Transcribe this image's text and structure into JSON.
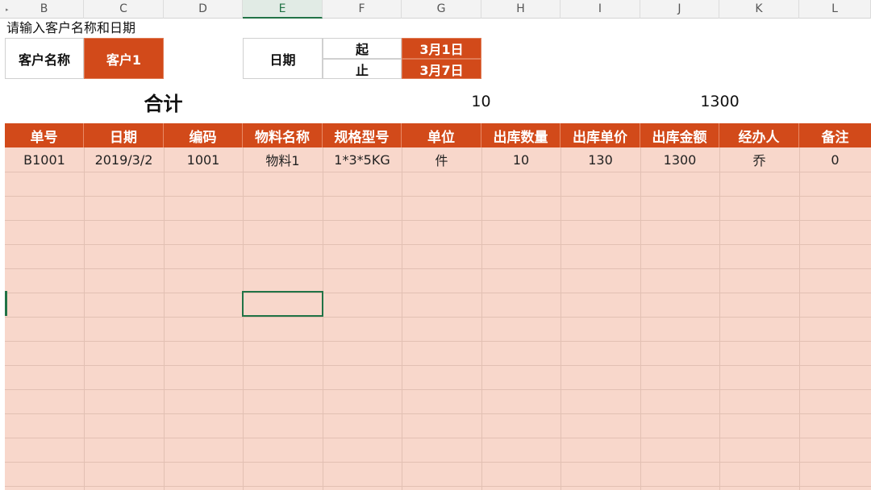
{
  "column_headers": [
    "B",
    "C",
    "D",
    "E",
    "F",
    "G",
    "H",
    "I",
    "J",
    "K",
    "L"
  ],
  "active_column": "E",
  "prompt_text": "请输入客户名称和日期",
  "customer": {
    "label": "客户名称",
    "value": "客户1"
  },
  "date_range": {
    "label": "日期",
    "start_label": "起",
    "start_value": "3月1日",
    "end_label": "止",
    "end_value": "3月7日"
  },
  "totals": {
    "label": "合计",
    "quantity": "10",
    "amount": "1300"
  },
  "table": {
    "headers": [
      "单号",
      "日期",
      "编码",
      "物料名称",
      "规格型号",
      "单位",
      "出库数量",
      "出库单价",
      "出库金额",
      "经办人",
      "备注"
    ],
    "rows": [
      [
        "B1001",
        "2019/3/2",
        "1001",
        "物料1",
        "1*3*5KG",
        "件",
        "10",
        "130",
        "1300",
        "乔",
        "0"
      ]
    ]
  },
  "colors": {
    "accent_orange": "#d24a1a",
    "body_fill": "#f8d7cb",
    "selection_green": "#217346"
  }
}
